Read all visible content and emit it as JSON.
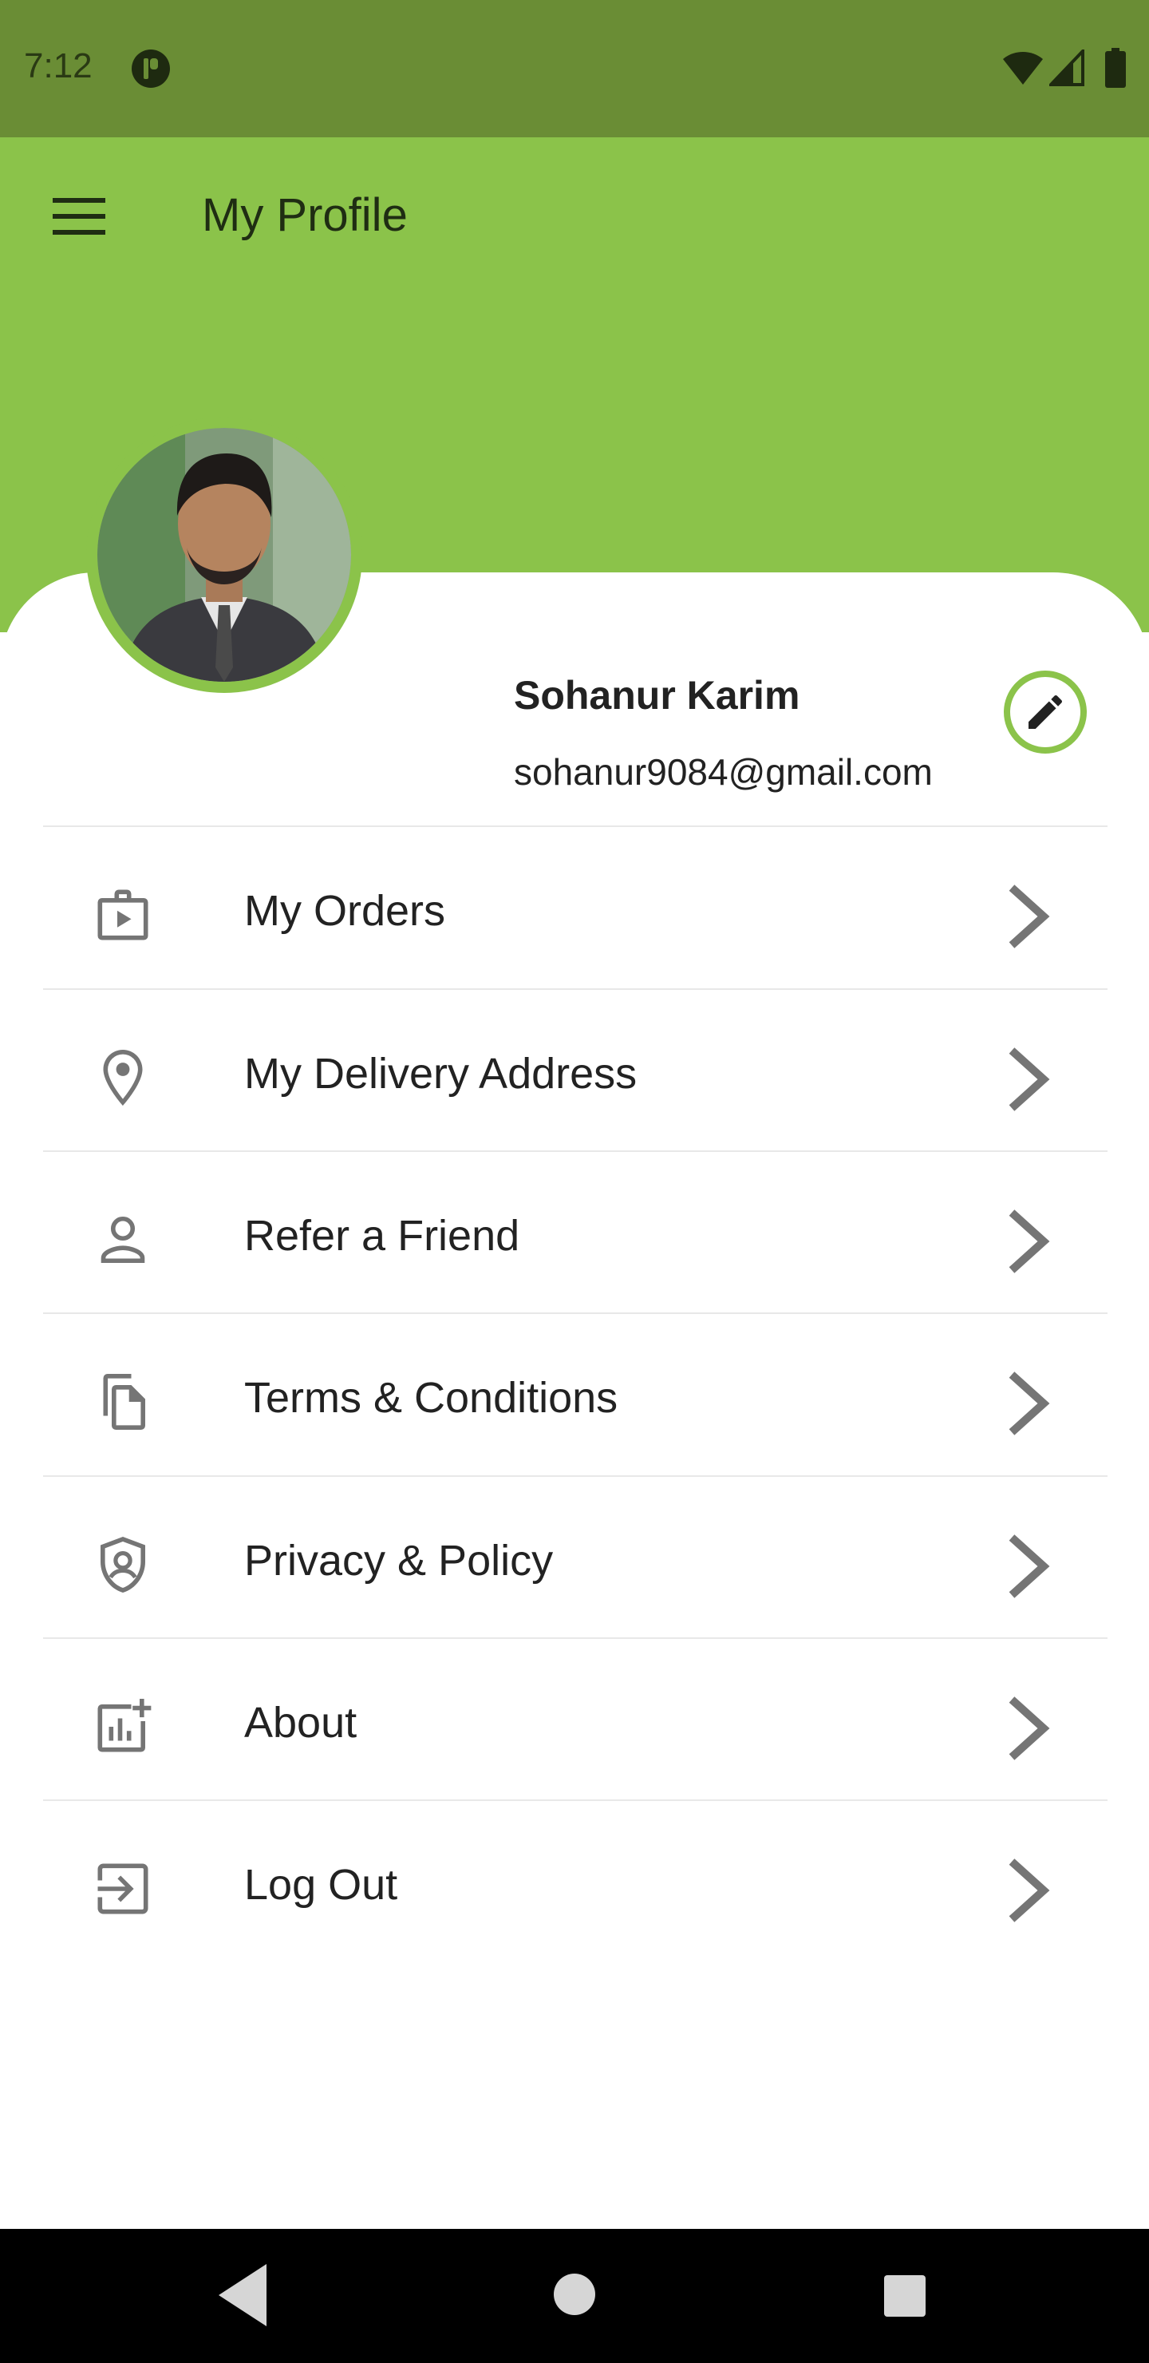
{
  "status_bar": {
    "time": "7:12",
    "icons": [
      "app-notification-icon",
      "wifi-icon",
      "signal-icon",
      "battery-icon"
    ]
  },
  "app_bar": {
    "title": "My Profile",
    "menu_icon": "hamburger-menu-icon"
  },
  "profile": {
    "name": "Sohanur Karim",
    "email": "sohanur9084@gmail.com",
    "edit_icon": "pencil-icon"
  },
  "menu": {
    "items": [
      {
        "label": "My Orders",
        "icon": "orders-bag-icon"
      },
      {
        "label": "My Delivery Address",
        "icon": "location-pin-icon"
      },
      {
        "label": "Refer a Friend",
        "icon": "person-icon"
      },
      {
        "label": "Terms & Conditions",
        "icon": "documents-icon"
      },
      {
        "label": "Privacy & Policy",
        "icon": "shield-icon"
      },
      {
        "label": "About",
        "icon": "analytics-icon"
      },
      {
        "label": "Log Out",
        "icon": "logout-icon"
      }
    ]
  },
  "nav_bar": {
    "icons": [
      "back-icon",
      "home-icon",
      "recents-icon"
    ]
  },
  "colors": {
    "status_bar": "#6a8d35",
    "accent": "#8bc34a",
    "text": "#222222",
    "icon_gray": "#757575",
    "nav_bar": "#000000"
  }
}
